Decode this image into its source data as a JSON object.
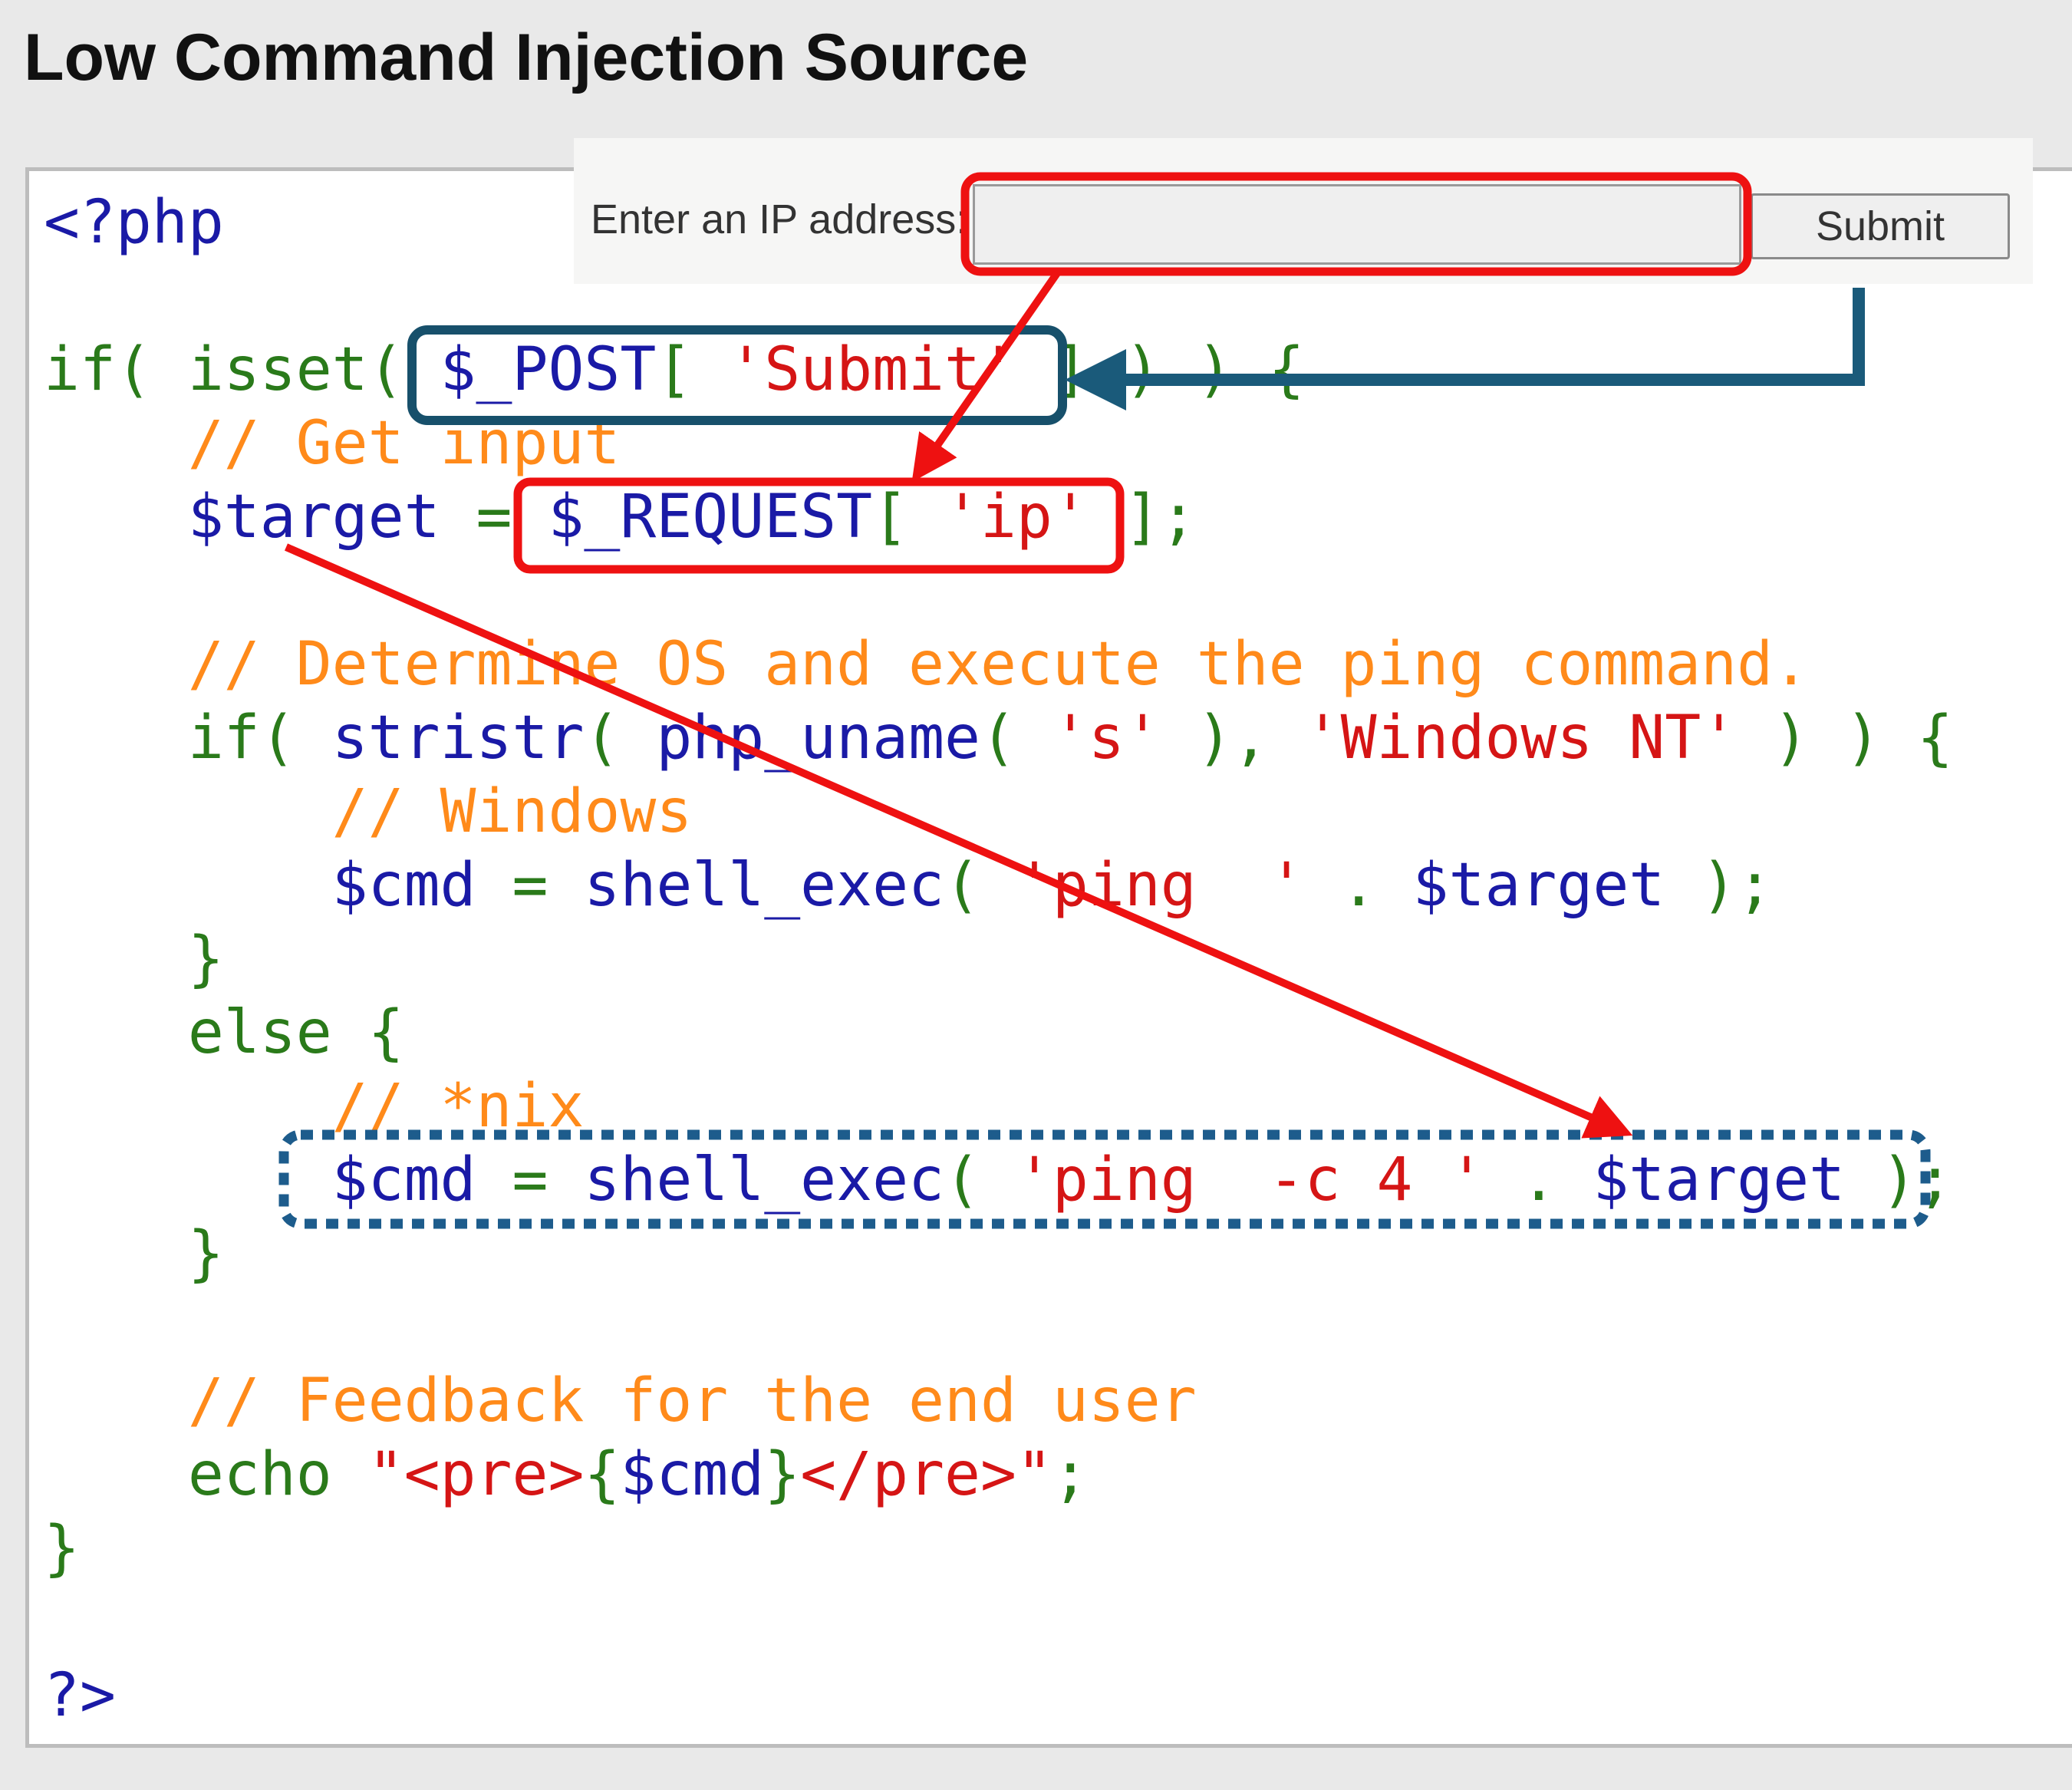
{
  "page": {
    "title": "Low Command Injection Source"
  },
  "form": {
    "label": "Enter an IP address:",
    "input_value": "",
    "input_placeholder": "",
    "submit_label": "Submit"
  },
  "code": {
    "lines": [
      [
        {
          "t": "<?php",
          "c": "blue"
        }
      ],
      [],
      [
        {
          "t": "if( isset( ",
          "c": "green"
        },
        {
          "t": "$_POST",
          "c": "blue"
        },
        {
          "t": "[ ",
          "c": "green"
        },
        {
          "t": "'Submit'",
          "c": "red"
        },
        {
          "t": " ] ) ) {",
          "c": "green"
        }
      ],
      [
        {
          "t": "    // Get input",
          "c": "orange"
        }
      ],
      [
        {
          "t": "    $target",
          "c": "blue"
        },
        {
          "t": " = ",
          "c": "green"
        },
        {
          "t": "$_REQUEST",
          "c": "blue"
        },
        {
          "t": "[ ",
          "c": "green"
        },
        {
          "t": "'ip'",
          "c": "red"
        },
        {
          "t": " ];",
          "c": "green"
        }
      ],
      [],
      [
        {
          "t": "    // Determine OS and execute the ping command.",
          "c": "orange"
        }
      ],
      [
        {
          "t": "    if( ",
          "c": "green"
        },
        {
          "t": "stristr",
          "c": "blue"
        },
        {
          "t": "( ",
          "c": "green"
        },
        {
          "t": "php_uname",
          "c": "blue"
        },
        {
          "t": "( ",
          "c": "green"
        },
        {
          "t": "'s'",
          "c": "red"
        },
        {
          "t": " ), ",
          "c": "green"
        },
        {
          "t": "'Windows NT'",
          "c": "red"
        },
        {
          "t": " ) ) {",
          "c": "green"
        }
      ],
      [
        {
          "t": "        // Windows",
          "c": "orange"
        }
      ],
      [
        {
          "t": "        $cmd",
          "c": "blue"
        },
        {
          "t": " = ",
          "c": "green"
        },
        {
          "t": "shell_exec",
          "c": "blue"
        },
        {
          "t": "( ",
          "c": "green"
        },
        {
          "t": "'ping  '",
          "c": "red"
        },
        {
          "t": " . ",
          "c": "green"
        },
        {
          "t": "$target",
          "c": "blue"
        },
        {
          "t": " );",
          "c": "green"
        }
      ],
      [
        {
          "t": "    }",
          "c": "green"
        }
      ],
      [
        {
          "t": "    else {",
          "c": "green"
        }
      ],
      [
        {
          "t": "        // *nix",
          "c": "orange"
        }
      ],
      [
        {
          "t": "        $cmd",
          "c": "blue"
        },
        {
          "t": " = ",
          "c": "green"
        },
        {
          "t": "shell_exec",
          "c": "blue"
        },
        {
          "t": "( ",
          "c": "green"
        },
        {
          "t": "'ping  -c 4 '",
          "c": "red"
        },
        {
          "t": " . ",
          "c": "green"
        },
        {
          "t": "$target",
          "c": "blue"
        },
        {
          "t": " );",
          "c": "green"
        }
      ],
      [
        {
          "t": "    }",
          "c": "green"
        }
      ],
      [],
      [
        {
          "t": "    // Feedback for the end user",
          "c": "orange"
        }
      ],
      [
        {
          "t": "    echo ",
          "c": "green"
        },
        {
          "t": "\"<pre>",
          "c": "red"
        },
        {
          "t": "{",
          "c": "green"
        },
        {
          "t": "$cmd",
          "c": "blue"
        },
        {
          "t": "}",
          "c": "green"
        },
        {
          "t": "</pre>\"",
          "c": "red"
        },
        {
          "t": ";",
          "c": "green"
        }
      ],
      [
        {
          "t": "}",
          "c": "green"
        }
      ],
      [],
      [
        {
          "t": "?>",
          "c": "blue"
        }
      ]
    ]
  },
  "colors": {
    "code_blue": "#1a1aa6",
    "code_green": "#2a7a1a",
    "code_red": "#d51515",
    "code_orange": "#ff8a1a",
    "annotation_red": "#ee1111",
    "annotation_teal": "#17506b",
    "annotation_arrow_teal": "#1a5a7a",
    "annotation_dotted_blue": "#1d5c8c"
  }
}
